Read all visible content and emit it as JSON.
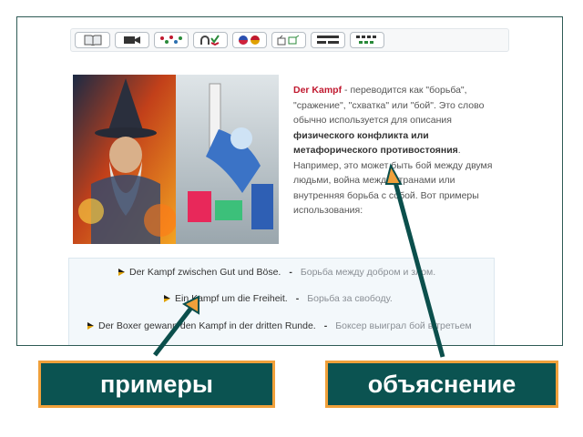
{
  "toolbar": {
    "buttons": [
      "book-icon",
      "video-camera-icon",
      "scramble-icon",
      "magnet-check-icon",
      "language-flags-icon",
      "thumbs-icon",
      "sentence-blocks-icon",
      "dots-icon"
    ]
  },
  "explanation": {
    "keyword": "Der Kampf",
    "text_1": " - переводится как \"борьба\", \"сражение\", \"схватка\"  или \"бой\". Это слово обычно используется для описания ",
    "bold_text": "физического конфликта или метафорического противостояния",
    "text_2": ". Например, это может быть бой между двумя людьми, война между странами или внутренняя борьба с собой. Вот примеры использования:"
  },
  "examples": [
    {
      "de": "Der Kampf zwischen Gut und Böse.",
      "sep": "-",
      "ru": "Борьба между добром и злом."
    },
    {
      "de": "Ein Kampf um die Freiheit.",
      "sep": "-",
      "ru": "Борьба за свободу."
    },
    {
      "de": "Der Boxer gewann den Kampf in der dritten Runde.",
      "sep": "-",
      "ru": "Боксер выиграл бой в третьем"
    }
  ],
  "callouts": {
    "examples_label": "примеры",
    "explanation_label": "объяснение"
  },
  "colors": {
    "accent_red": "#c0182f",
    "callout_bg": "#0b5351",
    "callout_border": "#f0a03a",
    "arrow": "#0b4f4c"
  }
}
